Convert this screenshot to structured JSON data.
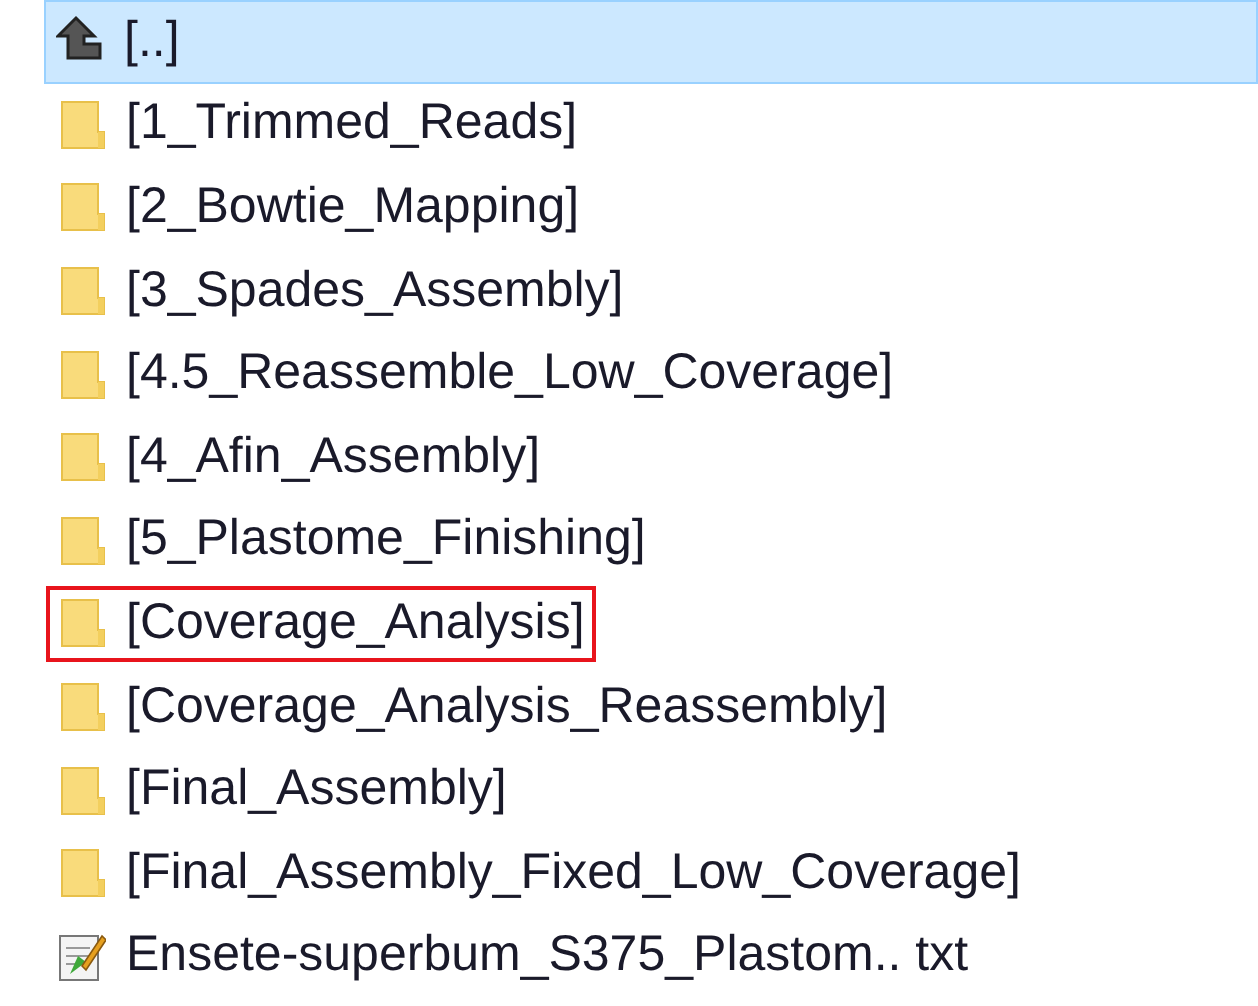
{
  "items": [
    {
      "kind": "parent",
      "label": "[..]",
      "selected": true,
      "outlined": false
    },
    {
      "kind": "folder",
      "label": "[1_Trimmed_Reads]",
      "selected": false,
      "outlined": false
    },
    {
      "kind": "folder",
      "label": "[2_Bowtie_Mapping]",
      "selected": false,
      "outlined": false
    },
    {
      "kind": "folder",
      "label": "[3_Spades_Assembly]",
      "selected": false,
      "outlined": false
    },
    {
      "kind": "folder",
      "label": "[4.5_Reassemble_Low_Coverage]",
      "selected": false,
      "outlined": false
    },
    {
      "kind": "folder",
      "label": "[4_Afin_Assembly]",
      "selected": false,
      "outlined": false
    },
    {
      "kind": "folder",
      "label": "[5_Plastome_Finishing]",
      "selected": false,
      "outlined": false
    },
    {
      "kind": "folder",
      "label": "[Coverage_Analysis]",
      "selected": false,
      "outlined": true
    },
    {
      "kind": "folder",
      "label": "[Coverage_Analysis_Reassembly]",
      "selected": false,
      "outlined": false
    },
    {
      "kind": "folder",
      "label": "[Final_Assembly]",
      "selected": false,
      "outlined": false
    },
    {
      "kind": "folder",
      "label": "[Final_Assembly_Fixed_Low_Coverage]",
      "selected": false,
      "outlined": false
    },
    {
      "kind": "file",
      "label": "Ensete-superbum_S375_Plastom.. txt",
      "selected": false,
      "outlined": false
    }
  ]
}
